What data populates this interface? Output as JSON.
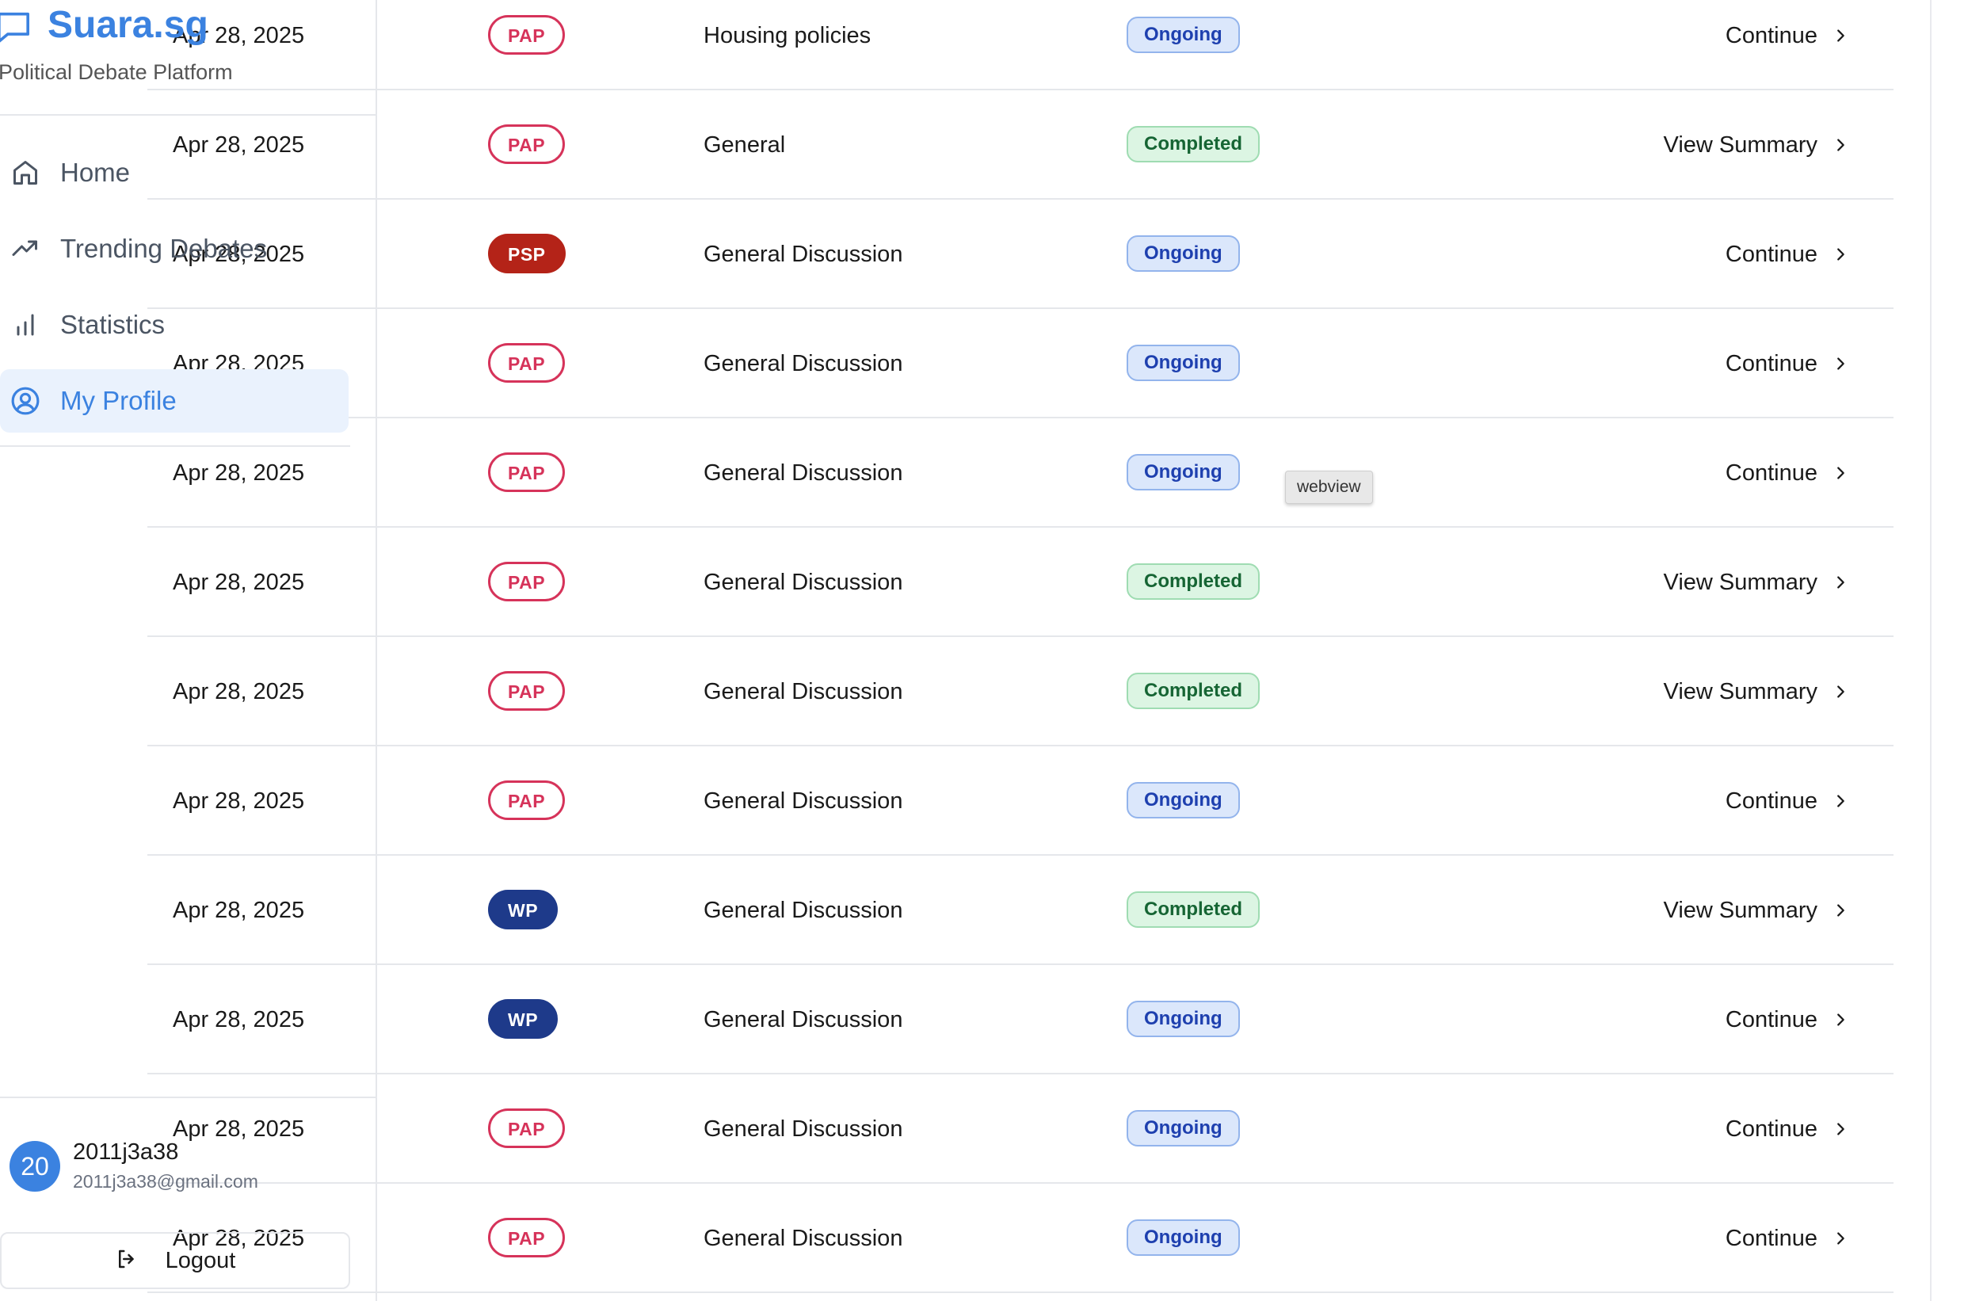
{
  "brand": {
    "name": "Suara.sg",
    "subtitle": "Political Debate Platform"
  },
  "nav": [
    {
      "label": "Home",
      "icon": "home-icon",
      "active": false
    },
    {
      "label": "Trending Debates",
      "icon": "trending-icon",
      "active": false
    },
    {
      "label": "Statistics",
      "icon": "bar-chart-icon",
      "active": false
    },
    {
      "label": "My Profile",
      "icon": "user-circle-icon",
      "active": true
    }
  ],
  "user": {
    "initials": "20",
    "name": "2011j3a38",
    "email": "2011j3a38@gmail.com"
  },
  "logout": {
    "label": "Logout"
  },
  "tooltip": {
    "text": "webview"
  },
  "colors": {
    "accent": "#3b82e0",
    "pap": "#d6335a",
    "psp": "#b42318",
    "wp": "#1e3a8a",
    "ongoing_bg": "#dbe7fb",
    "completed_bg": "#dcf5e3"
  },
  "debates": [
    {
      "date": "Apr 28, 2025",
      "party": "PAP",
      "party_style": "pap",
      "topic": "Housing policies",
      "status": "Ongoing",
      "status_style": "ongoing",
      "action": "Continue"
    },
    {
      "date": "Apr 28, 2025",
      "party": "PAP",
      "party_style": "pap",
      "topic": "General",
      "status": "Completed",
      "status_style": "completed",
      "action": "View Summary"
    },
    {
      "date": "Apr 28, 2025",
      "party": "PSP",
      "party_style": "psp",
      "topic": "General Discussion",
      "status": "Ongoing",
      "status_style": "ongoing",
      "action": "Continue"
    },
    {
      "date": "Apr 28, 2025",
      "party": "PAP",
      "party_style": "pap",
      "topic": "General Discussion",
      "status": "Ongoing",
      "status_style": "ongoing",
      "action": "Continue"
    },
    {
      "date": "Apr 28, 2025",
      "party": "PAP",
      "party_style": "pap",
      "topic": "General Discussion",
      "status": "Ongoing",
      "status_style": "ongoing",
      "action": "Continue"
    },
    {
      "date": "Apr 28, 2025",
      "party": "PAP",
      "party_style": "pap",
      "topic": "General Discussion",
      "status": "Completed",
      "status_style": "completed",
      "action": "View Summary"
    },
    {
      "date": "Apr 28, 2025",
      "party": "PAP",
      "party_style": "pap",
      "topic": "General Discussion",
      "status": "Completed",
      "status_style": "completed",
      "action": "View Summary"
    },
    {
      "date": "Apr 28, 2025",
      "party": "PAP",
      "party_style": "pap",
      "topic": "General Discussion",
      "status": "Ongoing",
      "status_style": "ongoing",
      "action": "Continue"
    },
    {
      "date": "Apr 28, 2025",
      "party": "WP",
      "party_style": "wp",
      "topic": "General Discussion",
      "status": "Completed",
      "status_style": "completed",
      "action": "View Summary"
    },
    {
      "date": "Apr 28, 2025",
      "party": "WP",
      "party_style": "wp",
      "topic": "General Discussion",
      "status": "Ongoing",
      "status_style": "ongoing",
      "action": "Continue"
    },
    {
      "date": "Apr 28, 2025",
      "party": "PAP",
      "party_style": "pap",
      "topic": "General Discussion",
      "status": "Ongoing",
      "status_style": "ongoing",
      "action": "Continue"
    },
    {
      "date": "Apr 28, 2025",
      "party": "PAP",
      "party_style": "pap",
      "topic": "General Discussion",
      "status": "Ongoing",
      "status_style": "ongoing",
      "action": "Continue"
    }
  ]
}
